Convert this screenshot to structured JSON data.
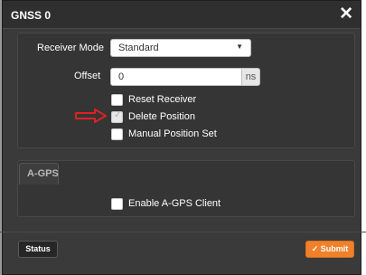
{
  "dialog": {
    "title": "GNSS 0",
    "close_glyph": "✕"
  },
  "form": {
    "receiver_mode_label": "Receiver Mode",
    "receiver_mode_value": "Standard",
    "dropdown_caret": "▼",
    "offset_label": "Offset",
    "offset_value": "0",
    "offset_unit": "ns",
    "checkboxes": [
      {
        "label": "Reset Receiver",
        "checked": false,
        "disabled": false
      },
      {
        "label": "Delete Position",
        "checked": true,
        "disabled": true
      },
      {
        "label": "Manual Position Set",
        "checked": false,
        "disabled": false
      }
    ]
  },
  "agps": {
    "section_label": "A-GPS",
    "enable_label": "Enable A-GPS Client",
    "enable_checked": false
  },
  "footer": {
    "status_label": "Status",
    "submit_label": "Submit",
    "submit_icon": "✓"
  },
  "colors": {
    "accent": "#f0812a",
    "dialog_bg": "#3a3a3a",
    "annotation_arrow": "#e02020"
  },
  "icons": {
    "close": "close-icon",
    "dropdown": "chevron-down-icon",
    "checkmark": "checkmark-icon",
    "annotation": "red-arrow-annotation"
  }
}
